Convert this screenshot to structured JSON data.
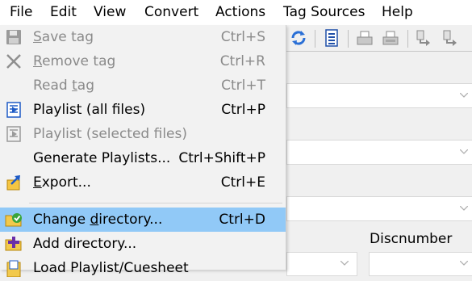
{
  "menubar": {
    "items": [
      {
        "label": "File"
      },
      {
        "label": "Edit"
      },
      {
        "label": "View"
      },
      {
        "label": "Convert"
      },
      {
        "label": "Actions"
      },
      {
        "label": "Tag Sources"
      },
      {
        "label": "Help"
      }
    ]
  },
  "file_menu": {
    "items": [
      {
        "pre": "",
        "u": "S",
        "post": "ave tag",
        "shortcut": "Ctrl+S",
        "icon": "floppy-disk-icon",
        "enabled": false
      },
      {
        "pre": "",
        "u": "R",
        "post": "emove tag",
        "shortcut": "Ctrl+R",
        "icon": "remove-x-icon",
        "enabled": false
      },
      {
        "pre": "Read ",
        "u": "t",
        "post": "ag",
        "shortcut": "Ctrl+T",
        "icon": "",
        "enabled": false
      },
      {
        "pre": "Playlist (all files)",
        "u": "",
        "post": "",
        "shortcut": "Ctrl+P",
        "icon": "playlist-icon",
        "enabled": true
      },
      {
        "pre": "Playlist (selected files)",
        "u": "",
        "post": "",
        "shortcut": "",
        "icon": "playlist-icon",
        "enabled": false
      },
      {
        "pre": "Generate Playlists...",
        "u": "",
        "post": "",
        "shortcut": "Ctrl+Shift+P",
        "icon": "",
        "enabled": true
      },
      {
        "pre": "",
        "u": "E",
        "post": "xport...",
        "shortcut": "Ctrl+E",
        "icon": "export-icon",
        "enabled": true
      },
      {
        "pre": "Change ",
        "u": "d",
        "post": "irectory...",
        "shortcut": "Ctrl+D",
        "icon": "folder-check-icon",
        "enabled": true,
        "highlighted": true
      },
      {
        "pre": "Add directory...",
        "u": "",
        "post": "",
        "shortcut": "",
        "icon": "folder-add-icon",
        "enabled": true
      },
      {
        "pre": "Load Playlist/Cuesheet",
        "u": "",
        "post": "",
        "shortcut": "",
        "icon": "load-playlist-icon",
        "enabled": true
      }
    ]
  },
  "editor": {
    "discnumber_label": "Discnumber"
  },
  "colors": {
    "highlight": "#91c9f7",
    "menu_bg": "#f2f2f2",
    "disabled_text": "#8a8a8a"
  }
}
